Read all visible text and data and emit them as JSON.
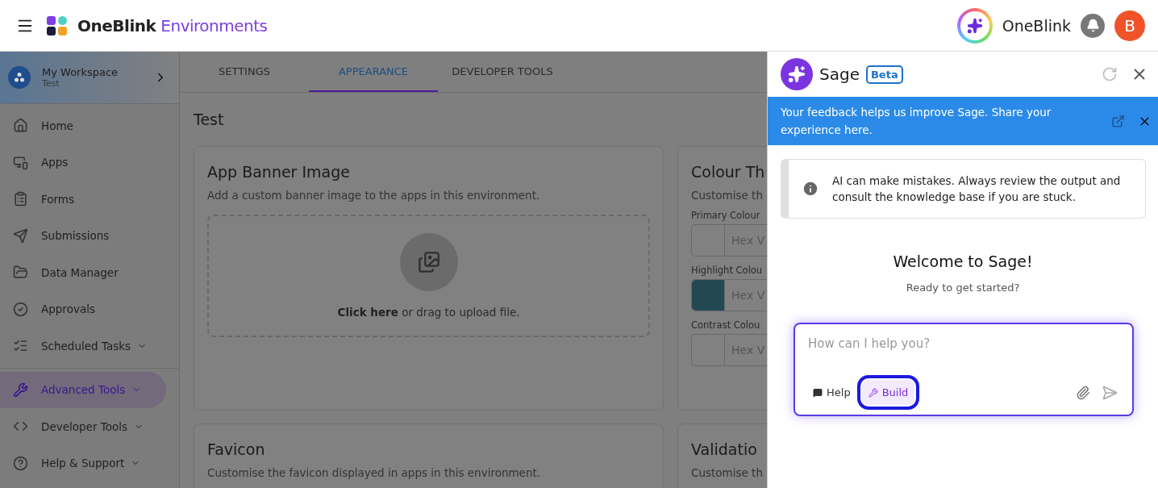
{
  "header": {
    "brand": "OneBlink",
    "product": "Environments",
    "assistant_label": "OneBlink",
    "avatar_initial": "B"
  },
  "sidebar": {
    "workspace": {
      "name": "My Workspace",
      "environment": "Test"
    },
    "sections": [
      [
        {
          "label": "Home",
          "selected": false,
          "expandable": false
        },
        {
          "label": "Apps",
          "selected": false,
          "expandable": false
        },
        {
          "label": "Forms",
          "selected": false,
          "expandable": false
        },
        {
          "label": "Submissions",
          "selected": false,
          "expandable": false
        },
        {
          "label": "Data Manager",
          "selected": false,
          "expandable": false
        },
        {
          "label": "Approvals",
          "selected": false,
          "expandable": false
        },
        {
          "label": "Scheduled Tasks",
          "selected": false,
          "expandable": true
        }
      ],
      [
        {
          "label": "Advanced Tools",
          "selected": true,
          "expandable": true
        },
        {
          "label": "Developer Tools",
          "selected": false,
          "expandable": true
        },
        {
          "label": "Help & Support",
          "selected": false,
          "expandable": true
        }
      ]
    ]
  },
  "tabs": [
    {
      "label": "SETTINGS",
      "selected": false
    },
    {
      "label": "APPEARANCE",
      "selected": true
    },
    {
      "label": "DEVELOPER TOOLS",
      "selected": false
    }
  ],
  "page_title": "Test",
  "cards": [
    {
      "kind": "upload",
      "title": "App Banner Image",
      "description": "Add a custom banner image to the apps in this environment.",
      "upload_link": "Click here",
      "upload_text": " or drag to upload file."
    },
    {
      "kind": "colours",
      "title": "Colour Th",
      "description": "Customise th",
      "fields": [
        {
          "label": "Primary Colour",
          "placeholder": "Hex V"
        },
        {
          "label": "Highlight Colou",
          "placeholder": "Hex V",
          "color": "#244852"
        },
        {
          "label": "Contrast Colou",
          "placeholder": "Hex V"
        }
      ]
    },
    {
      "kind": "plain",
      "title": "Favicon",
      "description": "Customise the favicon displayed in apps in this environment."
    },
    {
      "kind": "plain",
      "title": "Validatio",
      "description": "Customise th"
    }
  ],
  "sage": {
    "title": "Sage",
    "badge": "Beta",
    "banner": "Your feedback helps us improve Sage. Share your experience here.",
    "notice": "AI can make mistakes. Always review the output and consult the knowledge base if you are stuck.",
    "welcome": "Welcome to Sage!",
    "subtitle": "Ready to get started?",
    "input": {
      "placeholder": "How can I help you?"
    },
    "modes": [
      {
        "label": "Help",
        "selected": false
      },
      {
        "label": "Build",
        "selected": true
      }
    ]
  }
}
